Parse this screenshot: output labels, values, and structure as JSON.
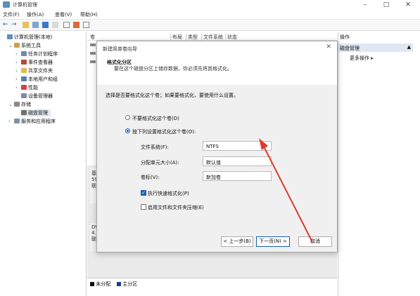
{
  "window": {
    "title": "计算机管理"
  },
  "menu": [
    "文件(F)",
    "操作(A)",
    "查看(V)",
    "帮助(H)"
  ],
  "tree": {
    "root": "计算机管理(本地)",
    "system_tools": "系统工具",
    "items": [
      "任务计划程序",
      "事件查看器",
      "共享文件夹",
      "本地用户和组",
      "性能",
      "设备管理器"
    ],
    "storage": "存储",
    "disk_management": "磁盘管理",
    "services": "服务和应用程序"
  },
  "columns": [
    "卷",
    "布局",
    "类型",
    "文件系统",
    "状态"
  ],
  "disk_panel": {
    "disk1_lines": [
      "基",
      "59",
      "联"
    ],
    "disk2_lines": [
      "DV",
      "4.3",
      "联"
    ]
  },
  "legend": {
    "unallocated": "未分配",
    "primary": "主分区"
  },
  "actions": {
    "header": "操作",
    "section": "磁盘管理",
    "more": "更多操作"
  },
  "dialog": {
    "title": "新建简单卷向导",
    "heading": "格式化分区",
    "description": "要在这个磁盘分区上储存数据，你必须先将其格式化。",
    "prompt": "选择是否要格式化这个卷；如果要格式化，要使用什么设置。",
    "option_no_format": "不要格式化这个卷(D)",
    "option_format": "按下列设置格式化这个卷(O):",
    "file_system_label": "文件系统(F):",
    "file_system_value": "NTFS",
    "allocation_label": "分配单元大小(A):",
    "allocation_value": "默认值",
    "volume_label_label": "卷标(V):",
    "volume_label_value": "新加卷",
    "quick_format": "执行快速格式化(P)",
    "compression": "启用文件和文件夹压缩(E)",
    "back": "< 上一步(B)",
    "next": "下一页(N) >",
    "cancel": "取消"
  },
  "colors": {
    "accent": "#1a5fb4",
    "arrow": "#e03a2f",
    "selection": "#dfe7f3"
  }
}
